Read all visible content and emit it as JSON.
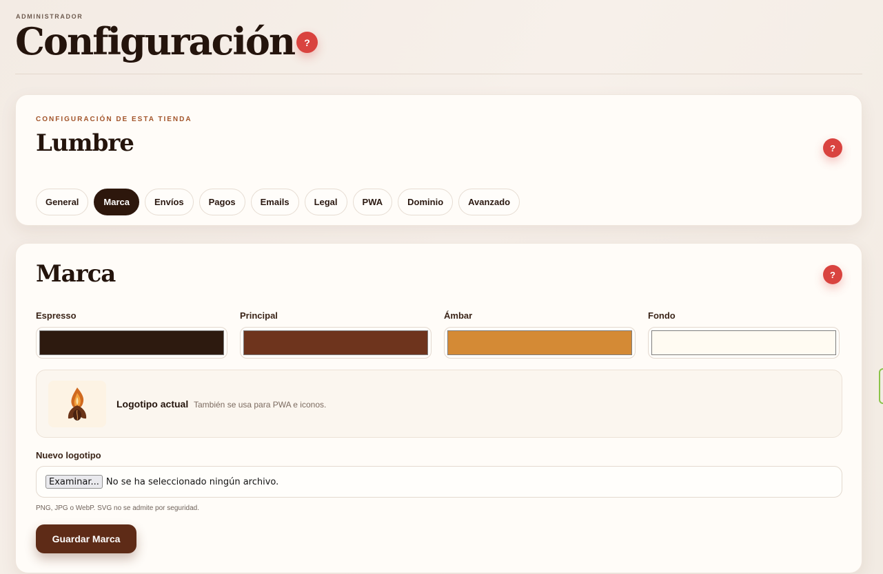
{
  "header": {
    "eyebrow": "ADMINISTRADOR",
    "title": "Configuración",
    "help_label": "?"
  },
  "store_card": {
    "eyebrow": "CONFIGURACIÓN DE ESTA TIENDA",
    "name": "Lumbre",
    "help_label": "?",
    "tabs": [
      {
        "label": "General",
        "active": false
      },
      {
        "label": "Marca",
        "active": true
      },
      {
        "label": "Envíos",
        "active": false
      },
      {
        "label": "Pagos",
        "active": false
      },
      {
        "label": "Emails",
        "active": false
      },
      {
        "label": "Legal",
        "active": false
      },
      {
        "label": "PWA",
        "active": false
      },
      {
        "label": "Dominio",
        "active": false
      },
      {
        "label": "Avanzado",
        "active": false
      }
    ]
  },
  "brand_card": {
    "title": "Marca",
    "help_label": "?",
    "colors": [
      {
        "label": "Espresso",
        "value": "#2d1a0f"
      },
      {
        "label": "Principal",
        "value": "#6e341d"
      },
      {
        "label": "Ámbar",
        "value": "#d48a35"
      },
      {
        "label": "Fondo",
        "value": "#fffbf2"
      }
    ],
    "logo": {
      "title": "Logotipo actual",
      "subtitle": "También se usa para PWA e iconos."
    },
    "new_logo_label": "Nuevo logotipo",
    "file_input": {
      "button_label": "Examinar...",
      "status": "No se ha seleccionado ningún archivo."
    },
    "hint": "PNG, JPG o WebP. SVG no se admite por seguridad.",
    "save_label": "Guardar Marca"
  },
  "icons": {
    "logo": "coffee-flame-logo-icon",
    "help": "help-icon"
  }
}
